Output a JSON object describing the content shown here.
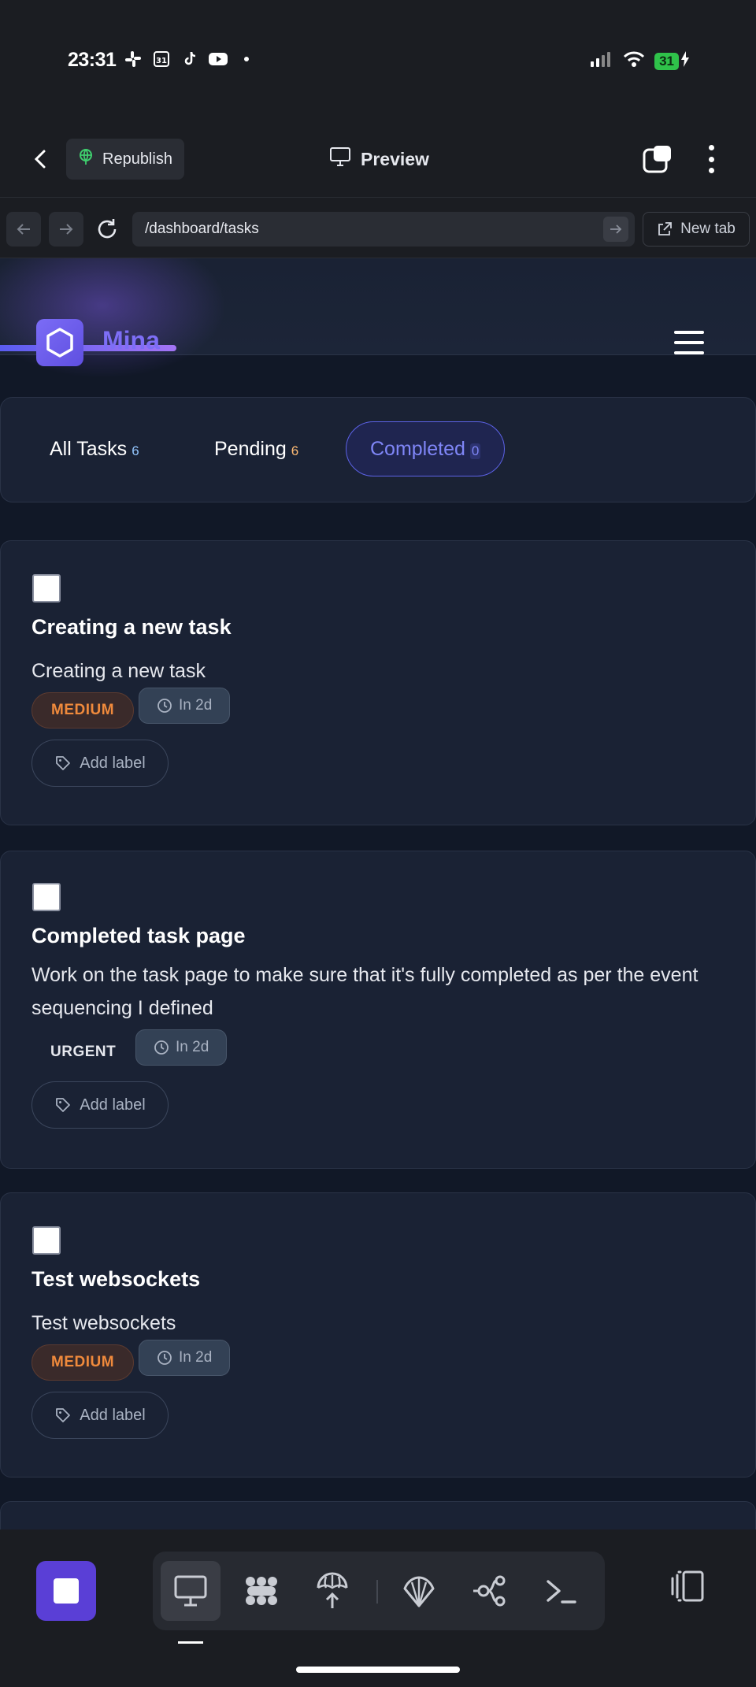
{
  "status_bar": {
    "time": "23:31",
    "notification_icons": [
      "slack-icon",
      "calendar-icon",
      "tiktok-icon",
      "youtube-icon",
      "dot-icon"
    ],
    "calendar_day": "31",
    "battery": "31"
  },
  "topbar": {
    "republish_label": "Republish",
    "preview_label": "Preview"
  },
  "browser": {
    "url": "/dashboard/tasks",
    "new_tab_label": "New tab"
  },
  "site": {
    "brand": "Mina",
    "filters": [
      {
        "label": "All Tasks",
        "count": "6",
        "count_color": "#93c5fd"
      },
      {
        "label": "Pending",
        "count": "6",
        "count_color": "#fdba74"
      },
      {
        "label": "Completed",
        "count": "0",
        "count_color": "#7f86f7"
      }
    ],
    "active_filter": "Completed"
  },
  "tasks": [
    {
      "title": "Creating a new task",
      "description": "Creating a new task",
      "priority": "MEDIUM",
      "due": "In 2d",
      "add_label": "Add label"
    },
    {
      "title": "Completed task page",
      "description": "Work on the task page to make sure that it's fully completed as per the event sequencing I defined",
      "priority": "URGENT",
      "due": "In 2d",
      "add_label": "Add label"
    },
    {
      "title": "Test websockets",
      "description": "Test websockets",
      "priority": "MEDIUM",
      "due": "In 2d",
      "add_label": "Add label"
    }
  ],
  "dock": {
    "tools": [
      "monitor-icon",
      "apps-grid-icon",
      "deploy-icon",
      "shell-icon",
      "branch-icon",
      "terminal-icon"
    ],
    "active_tool": "monitor-icon"
  },
  "colors": {
    "accent": "#7d6ef6",
    "medium": "#f08a3c",
    "background": "#111827",
    "card": "#1a2234"
  }
}
